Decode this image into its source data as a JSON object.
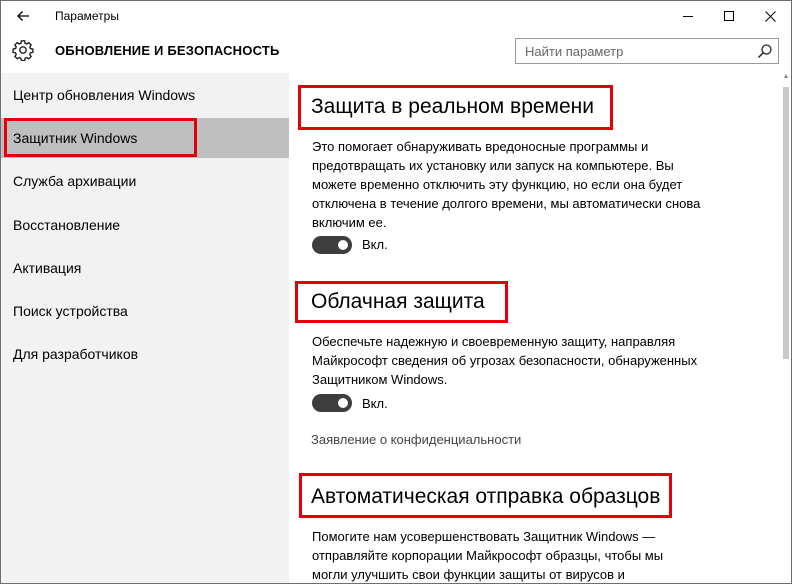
{
  "window": {
    "title": "Параметры"
  },
  "header": {
    "title": "ОБНОВЛЕНИЕ И БЕЗОПАСНОСТЬ",
    "search_placeholder": "Найти параметр"
  },
  "sidebar": {
    "items": [
      {
        "label": "Центр обновления Windows"
      },
      {
        "label": "Защитник Windows",
        "selected": true
      },
      {
        "label": "Служба архивации"
      },
      {
        "label": "Восстановление"
      },
      {
        "label": "Активация"
      },
      {
        "label": "Поиск устройства"
      },
      {
        "label": "Для разработчиков"
      }
    ]
  },
  "sections": {
    "realtime": {
      "title": "Защита в реальном времени",
      "description": "Это помогает обнаруживать вредоносные программы и предотвращать их установку или запуск на компьютере. Вы можете временно отключить эту функцию, но если она будет отключена в течение долгого времени, мы автоматически снова включим ее.",
      "toggle_state": "Вкл."
    },
    "cloud": {
      "title": "Облачная защита",
      "description": "Обеспечьте надежную и своевременную защиту, направляя Майкрософт сведения об угрозах безопасности, обнаруженных Защитником Windows.",
      "toggle_state": "Вкл.",
      "privacy_link": "Заявление о конфиденциальности"
    },
    "samples": {
      "title": "Автоматическая отправка образцов",
      "description": "Помогите нам усовершенствовать Защитник Windows — отправляйте корпорации Майкрософт образцы, чтобы мы могли улучшить свои функции защиты от вирусов и"
    }
  },
  "colors": {
    "highlight": "#e3000b",
    "selected_bg": "#bfbfbf",
    "sidebar_bg": "#f2f2f2",
    "toggle_on": "#3d3d3d"
  },
  "icons": [
    "back-arrow-icon",
    "minimize-icon",
    "maximize-icon",
    "close-icon",
    "gear-icon",
    "search-icon"
  ]
}
